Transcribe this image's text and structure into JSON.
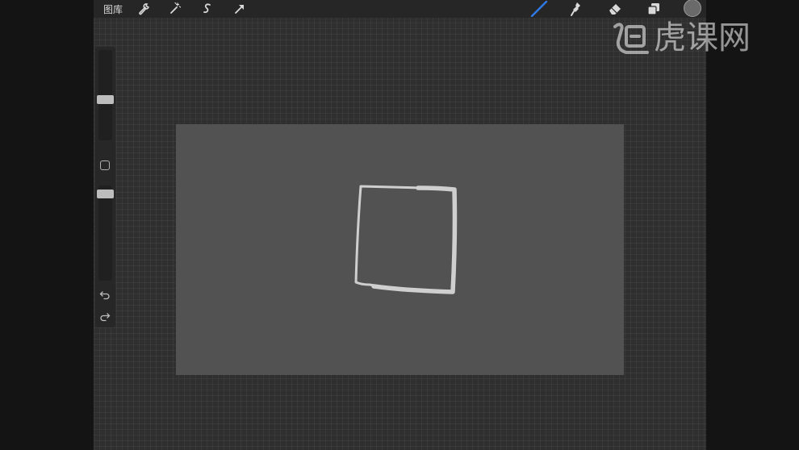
{
  "topbar": {
    "gallery_label": "图库",
    "left_tools": [
      "wrench-icon",
      "magic-wand-icon",
      "selection-s-icon",
      "transform-arrow-icon"
    ],
    "right_tools": [
      "brush-icon",
      "smudge-icon",
      "eraser-icon",
      "layers-icon"
    ],
    "active_tool": "brush-icon",
    "accent_color": "#2f7ae5"
  },
  "color_swatch": {
    "color": "#6a6a6a"
  },
  "sidebar": {
    "brush_size_level": 0.45,
    "opacity_level": 0.05,
    "icons": [
      "modify-square-icon",
      "undo-icon",
      "redo-icon"
    ]
  },
  "canvas": {
    "background": "#525252",
    "stroke_color": "#cfcfcf"
  },
  "watermark": {
    "text": "虎课网"
  }
}
